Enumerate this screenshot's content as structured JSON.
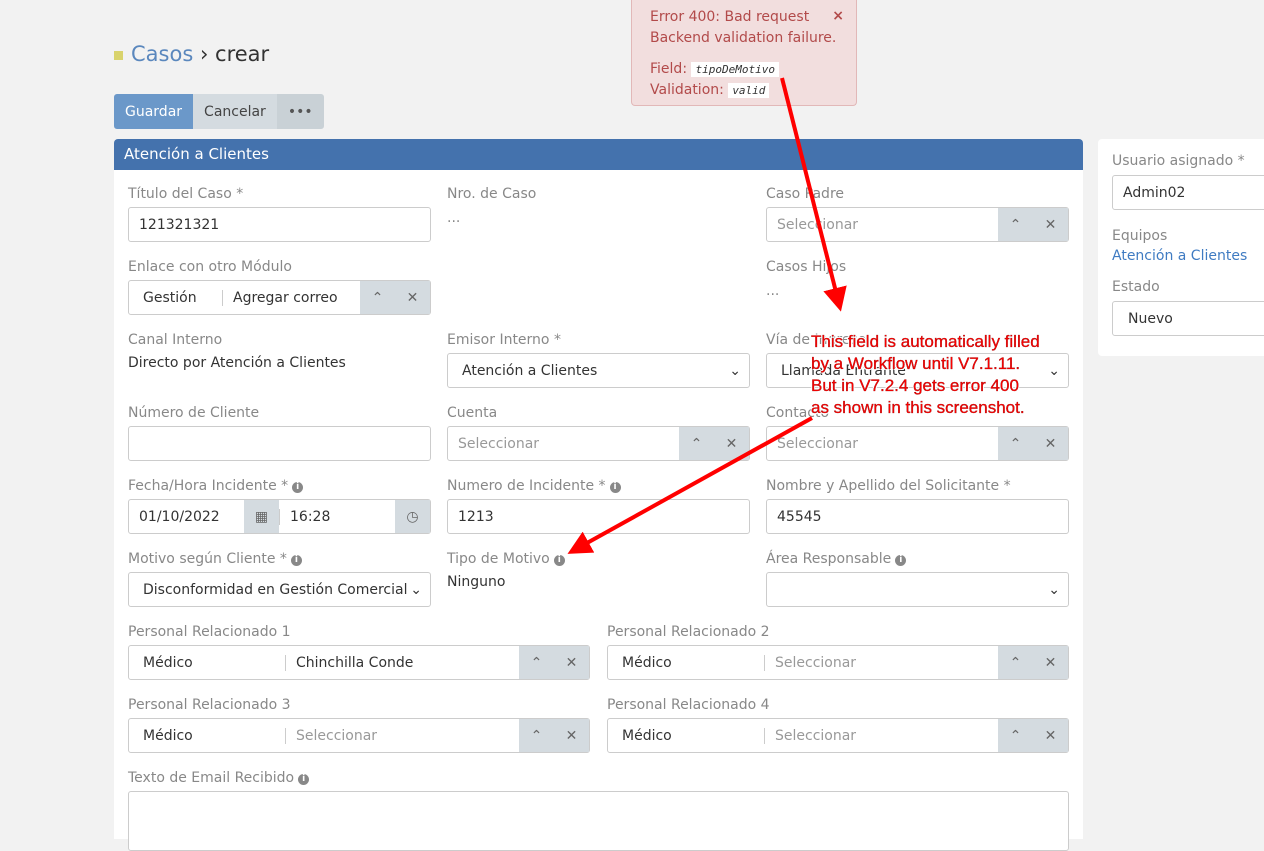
{
  "breadcrumb": {
    "parent": "Casos",
    "separator": "›",
    "current": "crear"
  },
  "toolbar": {
    "save": "Guardar",
    "cancel": "Cancelar",
    "more": "•••"
  },
  "alert": {
    "title": "Error 400: Bad request",
    "message": "Backend validation failure.",
    "field_label": "Field:",
    "field_value": "tipoDeMotivo",
    "validation_label": "Validation:",
    "validation_value": "valid",
    "close": "×"
  },
  "panel": {
    "title": "Atención a Clientes"
  },
  "fields": {
    "titulo": {
      "label": "Título del Caso *",
      "value": "121321321"
    },
    "nro": {
      "label": "Nro. de Caso",
      "value": "..."
    },
    "padre": {
      "label": "Caso Padre",
      "placeholder": "Seleccionar"
    },
    "enlace": {
      "label": "Enlace con otro Módulo",
      "type": "Gestión",
      "placeholder": "Agregar correo"
    },
    "hijos": {
      "label": "Casos Hijos",
      "value": "..."
    },
    "canal": {
      "label": "Canal Interno",
      "value": "Directo por Atención a Clientes"
    },
    "emisor": {
      "label": "Emisor Interno *",
      "value": "Atención a Clientes"
    },
    "via": {
      "label": "Vía de Ingreso",
      "value": "Llamada Entrante"
    },
    "numcliente": {
      "label": "Número de Cliente",
      "value": ""
    },
    "cuenta": {
      "label": "Cuenta",
      "placeholder": "Seleccionar"
    },
    "contacto": {
      "label": "Contacto",
      "placeholder": "Seleccionar"
    },
    "fecha": {
      "label": "Fecha/Hora Incidente *",
      "date": "01/10/2022",
      "time": "16:28"
    },
    "numinc": {
      "label": "Numero de Incidente *",
      "value": "1213"
    },
    "nombre": {
      "label": "Nombre y Apellido del Solicitante *",
      "value": "45545"
    },
    "motivo": {
      "label": "Motivo según Cliente *",
      "value": "Disconformidad en Gestión Comercial"
    },
    "tipo": {
      "label": "Tipo de Motivo",
      "value": "Ninguno"
    },
    "area": {
      "label": "Área Responsable",
      "value": ""
    },
    "p1": {
      "label": "Personal Relacionado 1",
      "type": "Médico",
      "value": "Chinchilla Conde"
    },
    "p2": {
      "label": "Personal Relacionado 2",
      "type": "Médico",
      "placeholder": "Seleccionar"
    },
    "p3": {
      "label": "Personal Relacionado 3",
      "type": "Médico",
      "placeholder": "Seleccionar"
    },
    "p4": {
      "label": "Personal Relacionado 4",
      "type": "Médico",
      "placeholder": "Seleccionar"
    },
    "email": {
      "label": "Texto de Email Recibido",
      "value": ""
    }
  },
  "side": {
    "usuario_label": "Usuario asignado *",
    "usuario": "Admin02",
    "equipos_label": "Equipos",
    "equipos": "Atención a Clientes",
    "estado_label": "Estado",
    "estado": "Nuevo"
  },
  "annotation": "This field is automatically filled by a Workflow until V7.1.11. But in V7.2.4 gets error 400 as shown in this screenshot."
}
